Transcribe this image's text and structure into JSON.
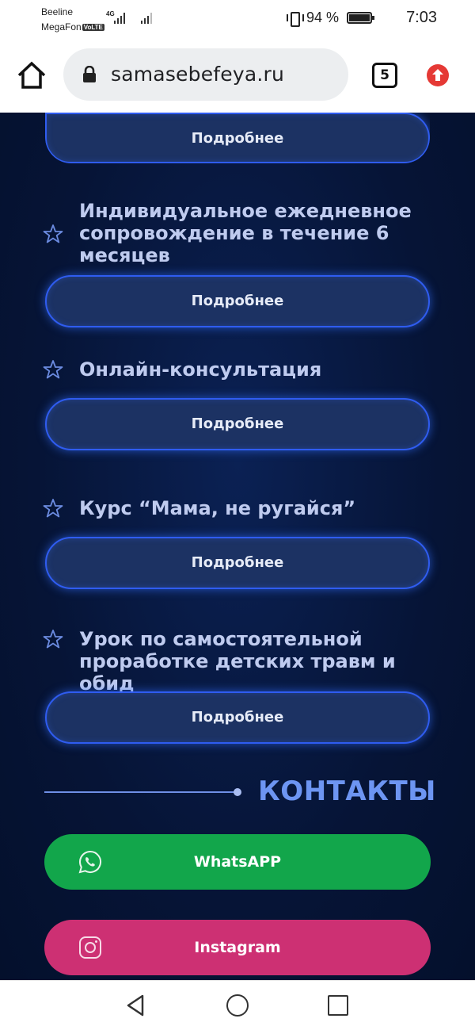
{
  "status_bar": {
    "carrier1": "Beeline",
    "carrier2": "MegaFon",
    "volte": "VoLTE",
    "network": "4G",
    "battery": "94 %",
    "time": "7:03"
  },
  "browser": {
    "url": "samasebefeya.ru",
    "tab_count": "5"
  },
  "services": [
    {
      "title": "",
      "button": "Подробнее"
    },
    {
      "title": "Индивидуальное ежедневное сопровождение в течение 6 месяцев",
      "button": "Подробнее"
    },
    {
      "title": "Онлайн-консультация",
      "button": "Подробнее"
    },
    {
      "title": "Курс “Мама, не ругайся”",
      "button": "Подробнее"
    },
    {
      "title": "Урок по самостоятельной проработке детских травм и обид",
      "button": "Подробнее"
    }
  ],
  "contacts": {
    "title": "КОНТАКТЫ",
    "whatsapp": "WhatsAPP",
    "instagram": "Instagram"
  },
  "colors": {
    "background": "#07153d",
    "button_border": "#2f5cf0",
    "whatsapp": "#12a64b",
    "instagram": "#cd3073",
    "accent": "#6d95f2"
  },
  "icons": [
    "home-icon",
    "lock-icon",
    "update-icon",
    "star-icon",
    "whatsapp-icon",
    "instagram-icon",
    "back-icon",
    "circle-home-icon",
    "recent-apps-icon"
  ]
}
